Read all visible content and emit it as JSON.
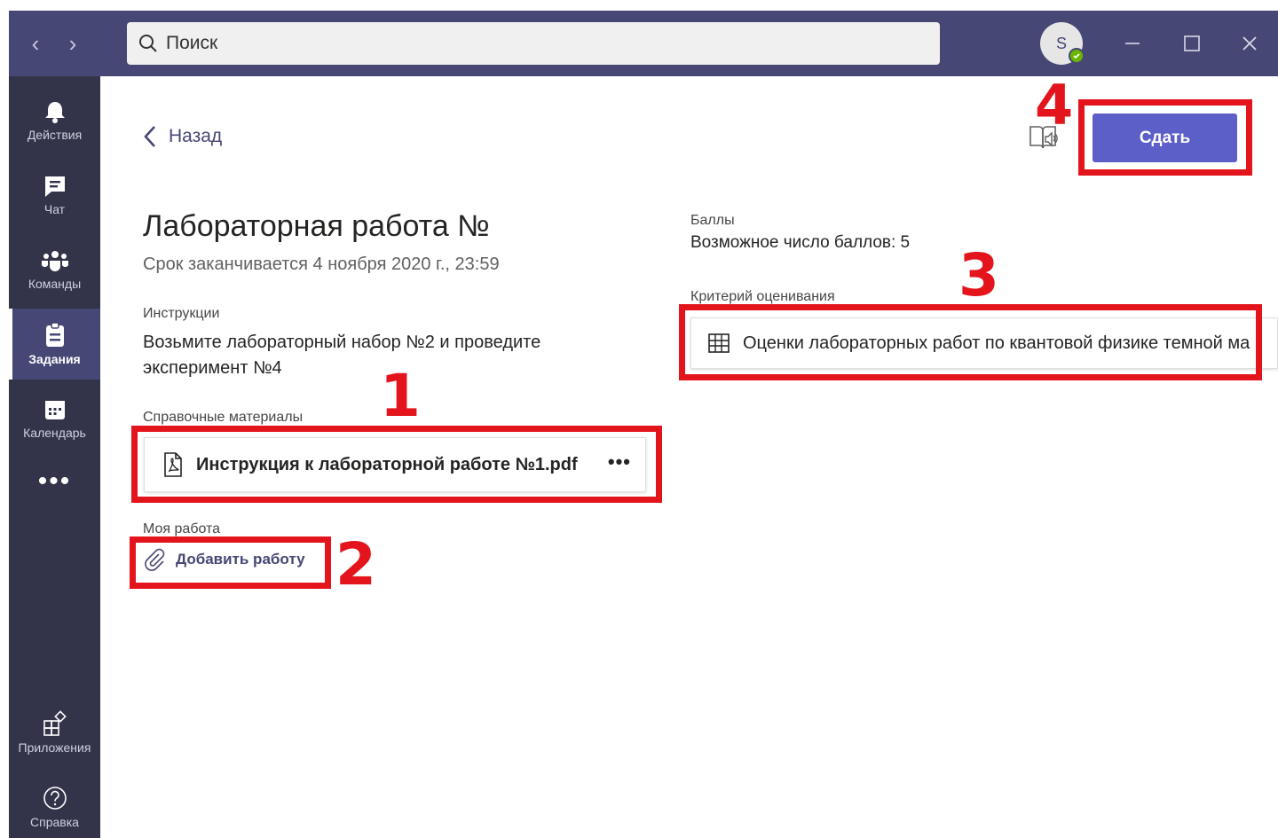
{
  "titlebar": {
    "search_placeholder": "Поиск",
    "avatar_initial": "S"
  },
  "rail": {
    "items": [
      {
        "label": "Действия",
        "icon": "bell-icon"
      },
      {
        "label": "Чат",
        "icon": "chat-icon"
      },
      {
        "label": "Команды",
        "icon": "teams-icon"
      },
      {
        "label": "Задания",
        "icon": "assignments-icon",
        "active": true
      },
      {
        "label": "Календарь",
        "icon": "calendar-icon"
      }
    ],
    "more": "•••",
    "bottom": [
      {
        "label": "Приложения",
        "icon": "apps-icon"
      },
      {
        "label": "Справка",
        "icon": "help-icon"
      }
    ]
  },
  "main": {
    "back_label": "Назад",
    "title": "Лабораторная работа №",
    "due": "Срок заканчивается 4 ноября 2020 г., 23:59",
    "instructions_label": "Инструкции",
    "instructions_text": "Возьмите лабораторный набор №2 и проведите эксперимент №4",
    "reference_label": "Справочные материалы",
    "reference_file": "Инструкция к лабораторной работе №1.pdf",
    "reference_more": "•••",
    "my_work_label": "Моя работа",
    "add_work_label": "Добавить работу",
    "points_label": "Баллы",
    "points_value": "Возможное число баллов: 5",
    "rubric_label": "Критерий оценивания",
    "rubric_name": "Оценки лабораторных работ по квантовой физике темной ма",
    "submit_label": "Сдать"
  },
  "annotations": {
    "n1": "1",
    "n2": "2",
    "n3": "3",
    "n4": "4",
    "color": "#e3141b"
  },
  "colors": {
    "titlebar": "#464775",
    "rail": "#33344a",
    "accent": "#5b5fc7",
    "presence": "#6bb700"
  }
}
